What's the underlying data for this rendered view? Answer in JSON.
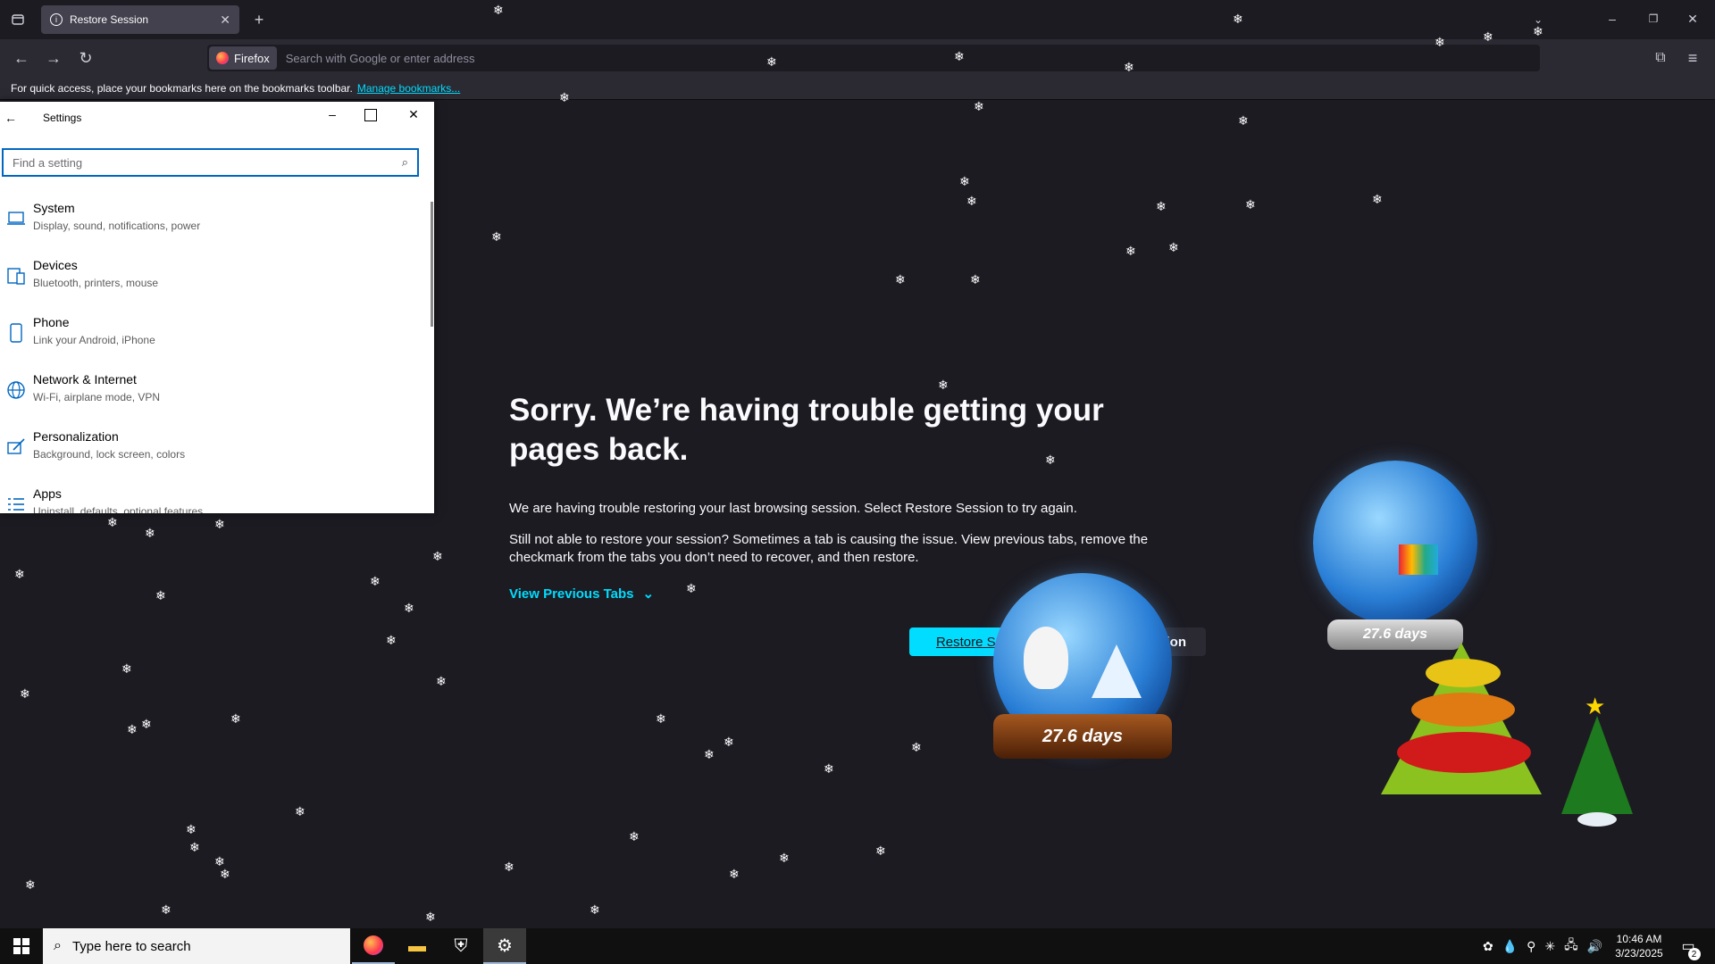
{
  "browser": {
    "tab_title": "Restore Session",
    "url_chip": "Firefox",
    "url_placeholder": "Search with Google or enter address",
    "bookmarks_msg": "For quick access, place your bookmarks here on the bookmarks toolbar.",
    "bookmarks_link": "Manage bookmarks..."
  },
  "error_page": {
    "title": "Sorry. We’re having trouble getting your pages back.",
    "para1": "We are having trouble restoring your last browsing session. Select Restore Session to try again.",
    "para2": "Still not able to restore your session? Sometimes a tab is causing the issue. View previous tabs, remove the checkmark from the tabs you don’t need to recover, and then restore.",
    "view_previous_tabs": "View Previous Tabs",
    "restore_button": "Restore Session",
    "new_session_button": "Start New Session"
  },
  "settings": {
    "window_title": "Settings",
    "search_placeholder": "Find a setting",
    "items": [
      {
        "title": "System",
        "subtitle": "Display, sound, notifications, power",
        "icon": "laptop-icon"
      },
      {
        "title": "Devices",
        "subtitle": "Bluetooth, printers, mouse",
        "icon": "devices-icon"
      },
      {
        "title": "Phone",
        "subtitle": "Link your Android, iPhone",
        "icon": "phone-icon"
      },
      {
        "title": "Network & Internet",
        "subtitle": "Wi-Fi, airplane mode, VPN",
        "icon": "globe-icon"
      },
      {
        "title": "Personalization",
        "subtitle": "Background, lock screen, colors",
        "icon": "pen-icon"
      },
      {
        "title": "Apps",
        "subtitle": "Uninstall, defaults, optional features",
        "icon": "apps-list-icon"
      }
    ]
  },
  "decorations": {
    "globe_counter_small": "27.6 days",
    "globe_counter_large": "27.6 days"
  },
  "taskbar": {
    "search_placeholder": "Type here to search",
    "time": "10:46 AM",
    "date": "3/23/2025",
    "notification_count": "2"
  },
  "colors": {
    "accent": "#00ddff",
    "page_bg": "#1c1b22",
    "toolbar_bg": "#2b2a33",
    "windows_accent": "#0067c0"
  }
}
